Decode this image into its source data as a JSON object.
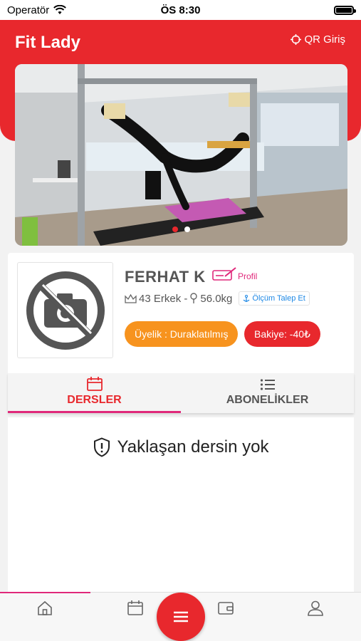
{
  "status_bar": {
    "carrier": "Operatör",
    "time": "ÖS 8:30"
  },
  "header": {
    "title": "Fit Lady",
    "qr_label": "QR Giriş"
  },
  "banner": {
    "slide_count": 2,
    "active_slide": 1
  },
  "profile": {
    "name": "FERHAT K",
    "profile_label": "Profil",
    "age_gender": "43 Erkek -",
    "weight": "56.0kg",
    "measure_label": "Ölçüm Talep Et",
    "membership": "Üyelik : Duraklatılmış",
    "balance": "Bakiye: -40₺"
  },
  "tabs": [
    {
      "label": "DERSLER",
      "icon": "calendar-icon",
      "active": true
    },
    {
      "label": "ABONELİKLER",
      "icon": "list-icon",
      "active": false
    }
  ],
  "empty_message": "Yaklaşan dersin yok",
  "bottom_nav": [
    "home-icon",
    "calendar-icon",
    "menu-icon",
    "wallet-icon",
    "user-icon"
  ],
  "colors": {
    "primary": "#e8282d",
    "accent": "#e0287a",
    "orange": "#f7931e",
    "link": "#1e88e5"
  }
}
